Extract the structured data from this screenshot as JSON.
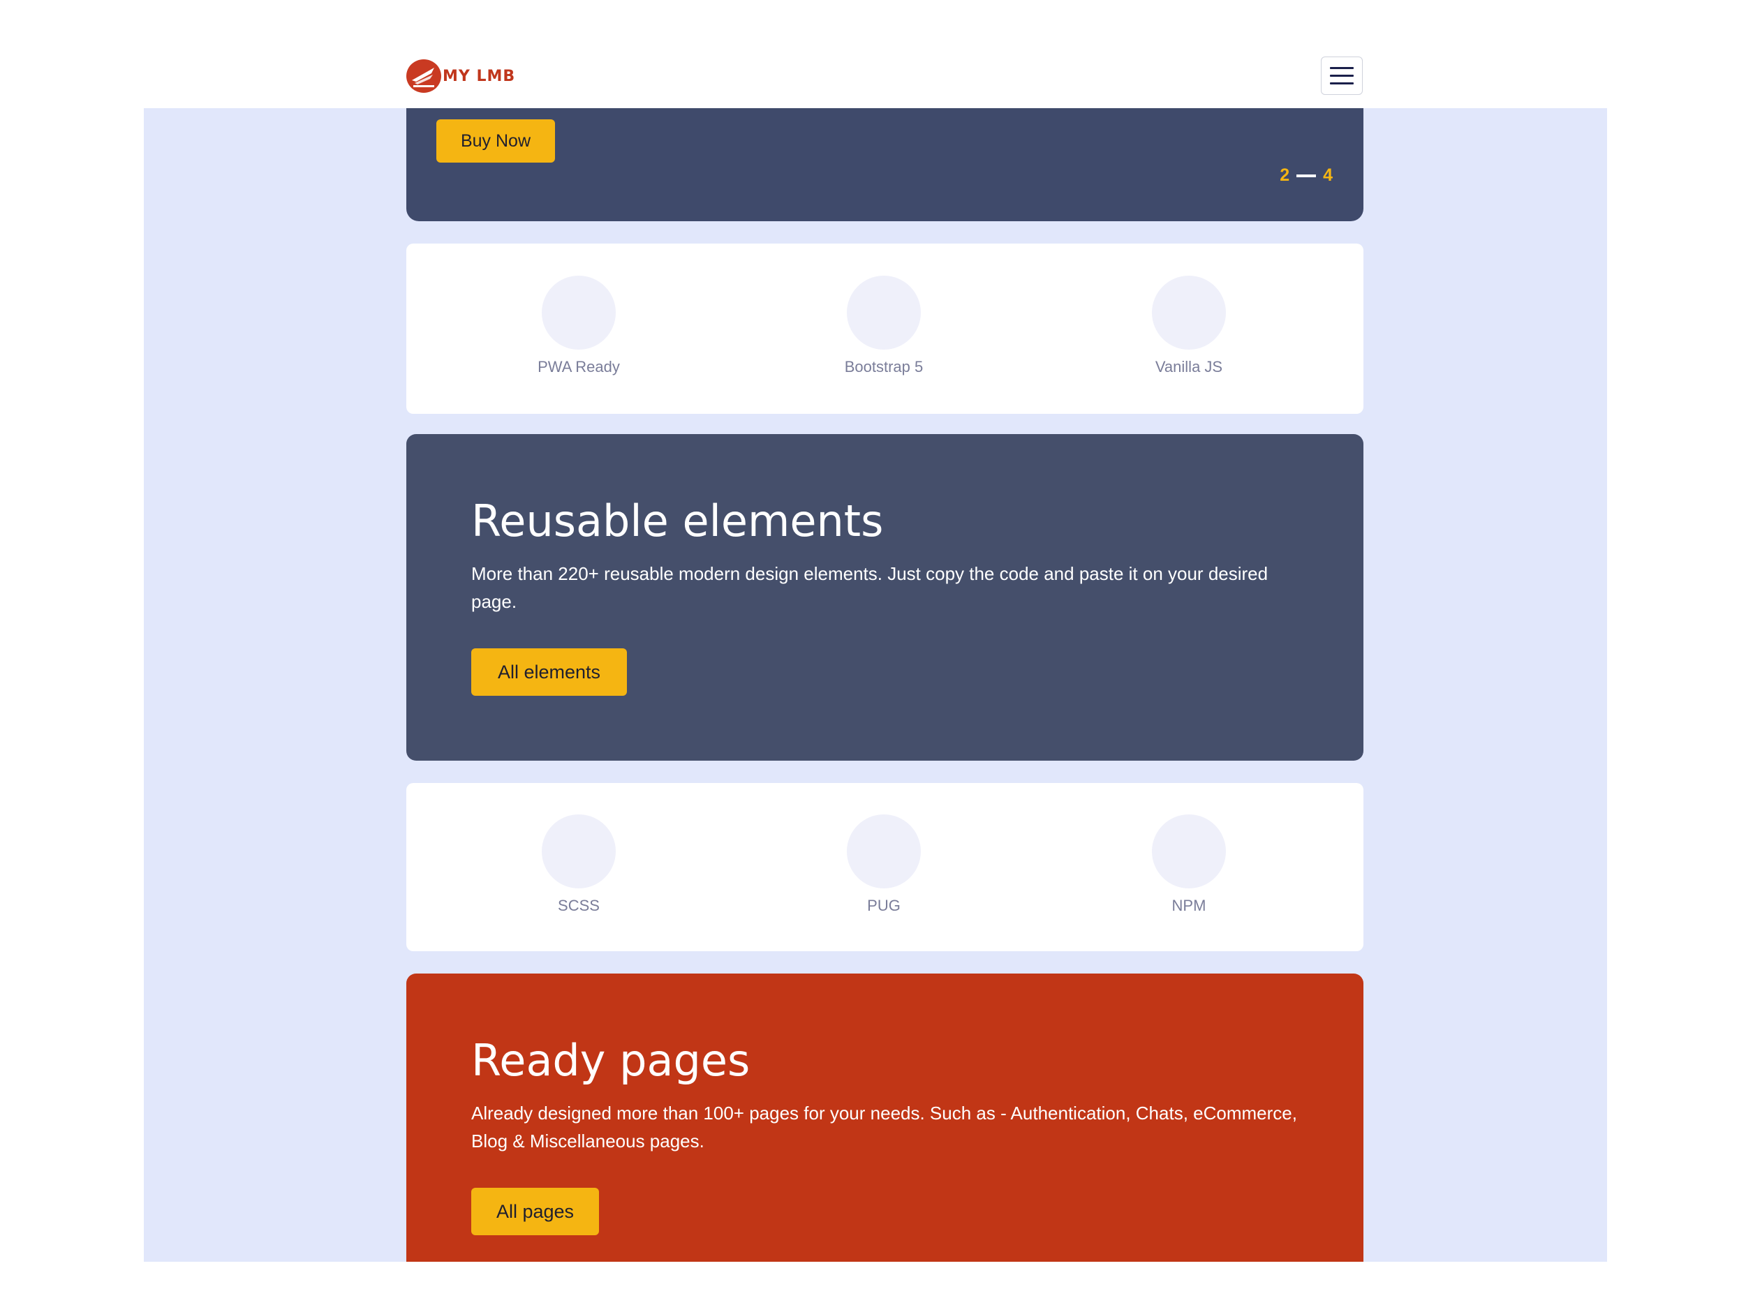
{
  "header": {
    "logo_text": "MY LMB",
    "menu_icon": "hamburger-icon"
  },
  "hero_slider": {
    "buy_button": "Buy Now",
    "counter_current": "2",
    "counter_total": "4"
  },
  "features_row_1": [
    {
      "label": "PWA Ready"
    },
    {
      "label": "Bootstrap 5"
    },
    {
      "label": "Vanilla JS"
    }
  ],
  "reusable": {
    "title": "Reusable elements",
    "description": "More than 220+ reusable modern design elements. Just copy the code and paste it on your desired page.",
    "button": "All elements",
    "bg_color": "#454f6b"
  },
  "features_row_2": [
    {
      "label": "SCSS"
    },
    {
      "label": "PUG"
    },
    {
      "label": "NPM"
    }
  ],
  "ready_pages": {
    "title": "Ready pages",
    "description": "Already designed more than 100+ pages for your needs. Such as - Authentication, Chats, eCommerce, Blog & Miscellaneous pages.",
    "button": "All pages",
    "bg_color": "#c13616"
  },
  "colors": {
    "accent_yellow": "#f5b512",
    "page_background": "#e1e7fb"
  }
}
